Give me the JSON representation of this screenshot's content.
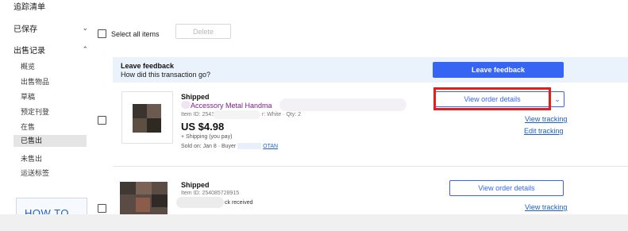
{
  "sidebar": {
    "watchlist": "追踪清单",
    "saved": "已保存",
    "selling_section": "出售记录",
    "sub_items": [
      {
        "label": "概览"
      },
      {
        "label": "出售物品"
      },
      {
        "label": "草稿"
      },
      {
        "label": "预定刊登"
      },
      {
        "label": "在售"
      },
      {
        "label": "已售出"
      },
      {
        "label": "未售出"
      },
      {
        "label": "运送标签"
      }
    ],
    "active_item": "已售出",
    "promo_text": "HOW TO"
  },
  "toolbar": {
    "select_all_label": "Select all items",
    "delete_label": "Delete"
  },
  "feedback": {
    "title": "Leave feedback",
    "subtitle": "How did this transaction go?",
    "button_label": "Leave feedback"
  },
  "orders": [
    {
      "status": "Shipped",
      "title": "Accessory Metal Handma",
      "item_id": "Item ID: 254177",
      "variation": "r: White · Qty: 2",
      "price": "US $4.98",
      "shipping": "+ Shipping (you pay)",
      "sold_on": "Sold on: Jan 8 · Buyer",
      "buyer": "OTAN",
      "view_details_label": "View order details",
      "more_label": "⌄",
      "view_tracking_label": "View tracking",
      "edit_tracking_label": "Edit tracking"
    },
    {
      "status": "Shipped",
      "item_id": "Item ID: 254085728915",
      "note": "ck received",
      "view_details_label": "View order details",
      "view_tracking_label": "View tracking"
    }
  ],
  "colors": {
    "primary_blue": "#3665f3",
    "banner_bg": "#eaf3fb",
    "highlight_red": "#e0201c",
    "title_purple": "#7a1f8a"
  }
}
